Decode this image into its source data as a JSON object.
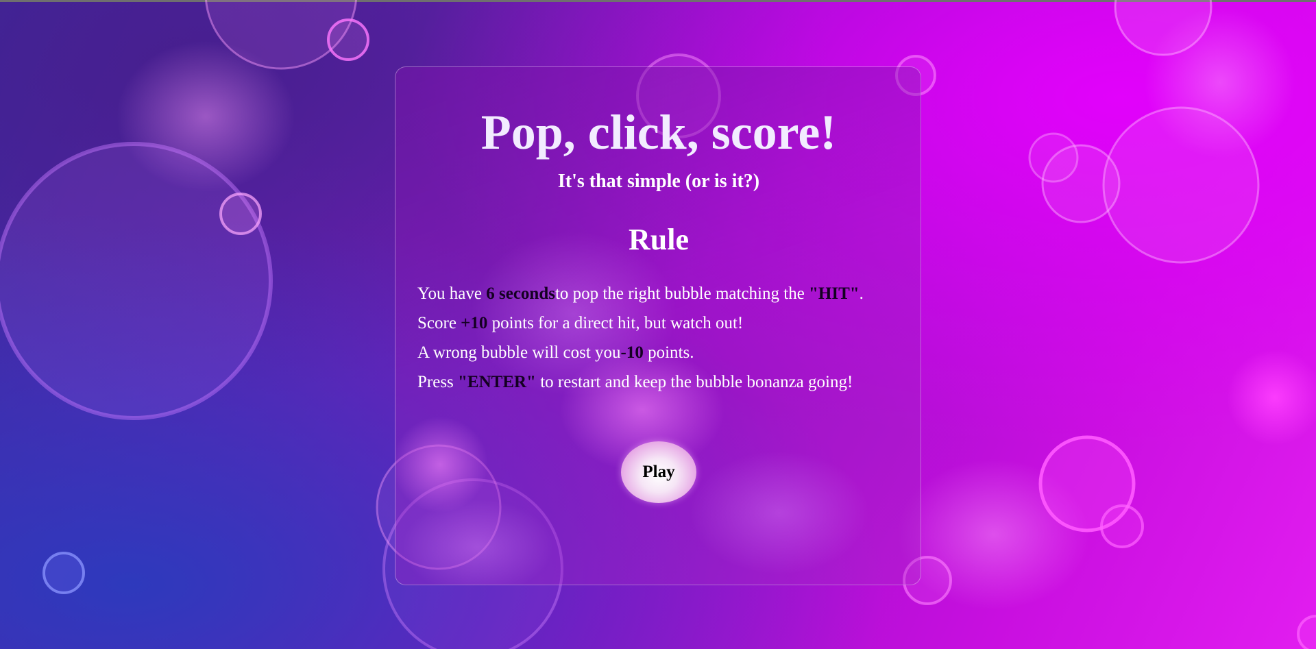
{
  "page": {
    "title": "Pop, click, score!",
    "subtitle": "It's that simple (or is it?)",
    "rule_heading": "Rule"
  },
  "rules": {
    "line1": {
      "pre": "You have ",
      "seconds": "6 seconds",
      "mid": "to pop the right bubble matching the ",
      "hit": "\"HIT\"",
      "post": "."
    },
    "line2": {
      "pre": "Score ",
      "points": "+10",
      "post": " points for a direct hit, but watch out!"
    },
    "line3": {
      "pre": "A wrong bubble will cost you",
      "points": "-10",
      "post": " points."
    },
    "line4": {
      "pre": "Press ",
      "key": "\"ENTER\"",
      "post": " to restart and keep the bubble bonanza going!"
    }
  },
  "play_button": {
    "label": "Play"
  },
  "colors": {
    "background_start": "#3b2a9e",
    "background_end": "#e21df0",
    "highlight_text": "#140022",
    "text": "#ffffff"
  }
}
